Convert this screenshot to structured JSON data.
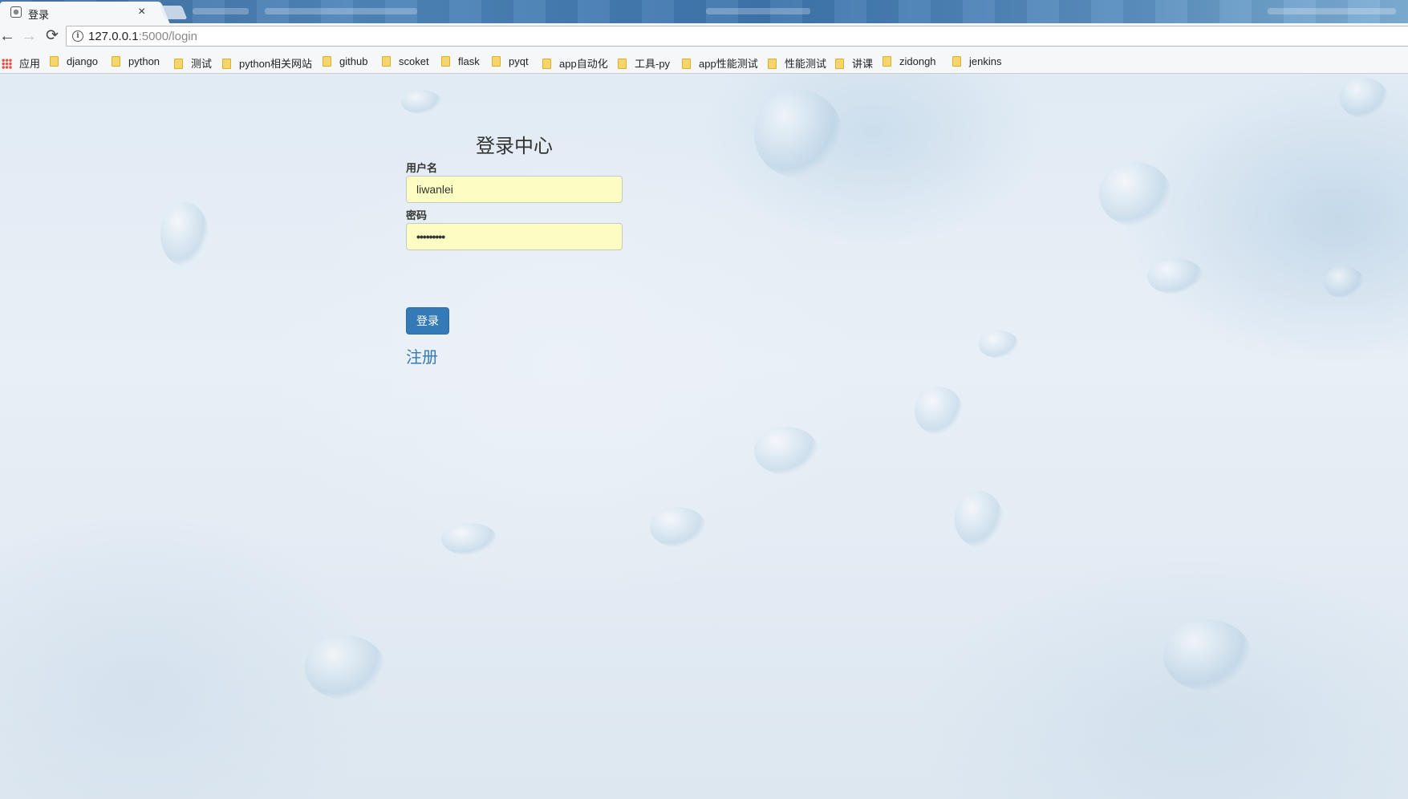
{
  "tab": {
    "title": "登录",
    "close": "×"
  },
  "toolbar": {
    "back": "←",
    "forward": "→",
    "reload": "⟳",
    "info": "i",
    "url_host": "127.0.0.1",
    "url_path": ":5000/login"
  },
  "bookmarks": {
    "apps": "应用",
    "items": [
      "django",
      "python",
      "测试",
      "python相关网站",
      "github",
      "scoket",
      "flask",
      "pyqt",
      "app自动化",
      "工具-py",
      "app性能测试",
      "性能测试",
      "讲课",
      "zidongh",
      "jenkins"
    ]
  },
  "login": {
    "title": "登录中心",
    "username_label": "用户名",
    "username_value": "liwanlei",
    "password_label": "密码",
    "password_mask": "•••••••••",
    "submit_label": "登录",
    "register_label": "注册"
  },
  "colors": {
    "primary": "#337ab7",
    "autofill": "#fcfdc2"
  }
}
